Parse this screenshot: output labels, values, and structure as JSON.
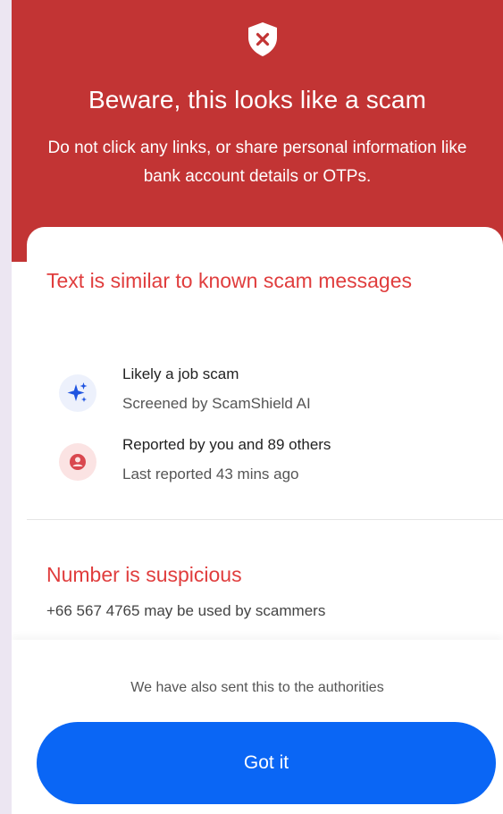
{
  "header": {
    "icon": "shield-x-icon",
    "title": "Beware, this looks like a scam",
    "subtitle": "Do not click any links, or share personal information like bank account details or OTPs."
  },
  "card": {
    "text_section": {
      "heading": "Text is similar to known scam messages",
      "items": [
        {
          "icon": "ai-sparkle-icon",
          "title": "Likely a job scam",
          "subtitle": "Screened by ScamShield AI"
        },
        {
          "icon": "user-icon",
          "title": "Reported by you and 89 others",
          "subtitle": "Last reported 43 mins ago"
        }
      ]
    },
    "number_section": {
      "heading": "Number is suspicious",
      "note": "+66 567 4765 may be used by scammers"
    }
  },
  "footer": {
    "authorities_note": "We have also sent this to the authorities",
    "button_label": "Got it"
  },
  "colors": {
    "header_bg": "#C23434",
    "heading_red": "#E03D3D",
    "primary_button": "#0A66F5",
    "backdrop": "#ECE6F2"
  }
}
